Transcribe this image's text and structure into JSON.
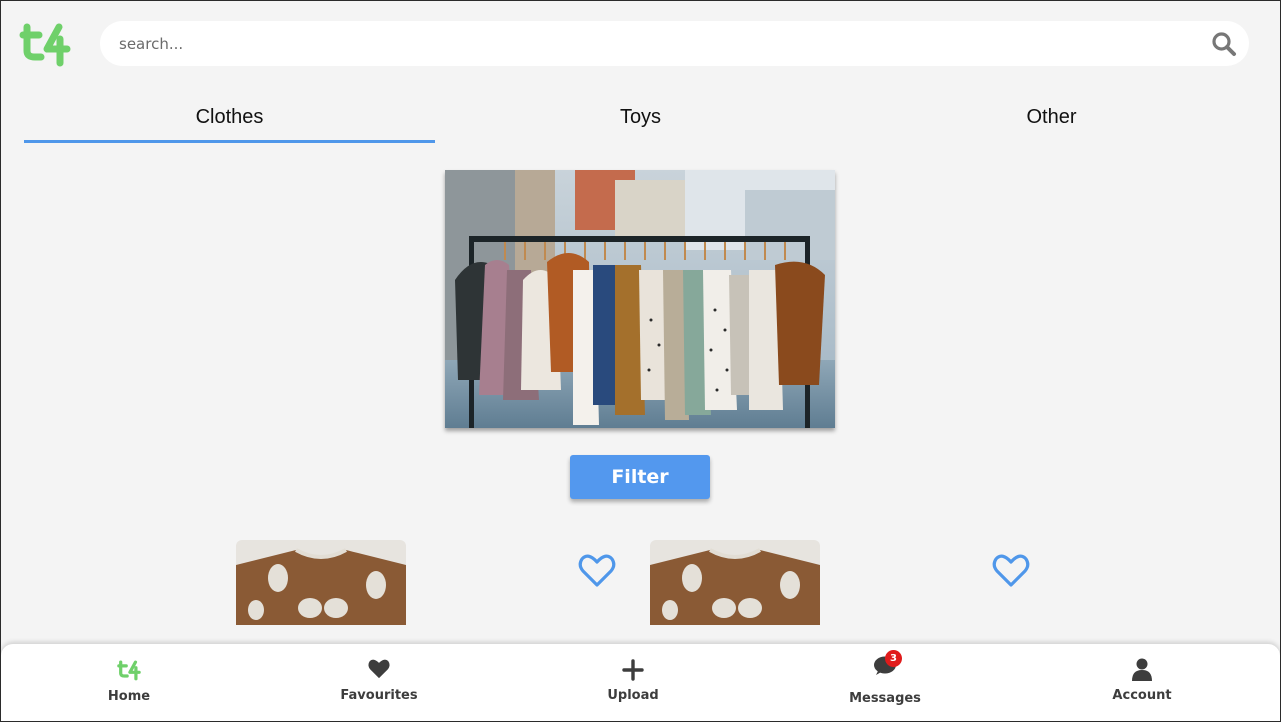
{
  "brand": {
    "accent_color": "#6fd06a",
    "logo_icon": "t4-logo-icon"
  },
  "search": {
    "placeholder": "search...",
    "value": "",
    "icon": "search-icon"
  },
  "tabs": [
    {
      "label": "Clothes",
      "active": true
    },
    {
      "label": "Toys",
      "active": false
    },
    {
      "label": "Other",
      "active": false
    }
  ],
  "hero": {
    "image": "clothes-rack-photo"
  },
  "filter": {
    "label": "Filter",
    "color": "#5398ee"
  },
  "products": [
    {
      "image": "brown-poodle-sweater-photo",
      "favourite_icon": "heart-outline-icon"
    },
    {
      "image": "brown-poodle-sweater-photo",
      "favourite_icon": "heart-outline-icon"
    }
  ],
  "bottom_nav": {
    "items": [
      {
        "label": "Home",
        "icon": "t4-logo-icon",
        "active": true
      },
      {
        "label": "Favourites",
        "icon": "heart-icon",
        "active": false
      },
      {
        "label": "Upload",
        "icon": "plus-icon",
        "active": false
      },
      {
        "label": "Messages",
        "icon": "chat-bubble-icon",
        "badge": "3",
        "active": false
      },
      {
        "label": "Account",
        "icon": "user-icon",
        "active": false
      }
    ]
  }
}
